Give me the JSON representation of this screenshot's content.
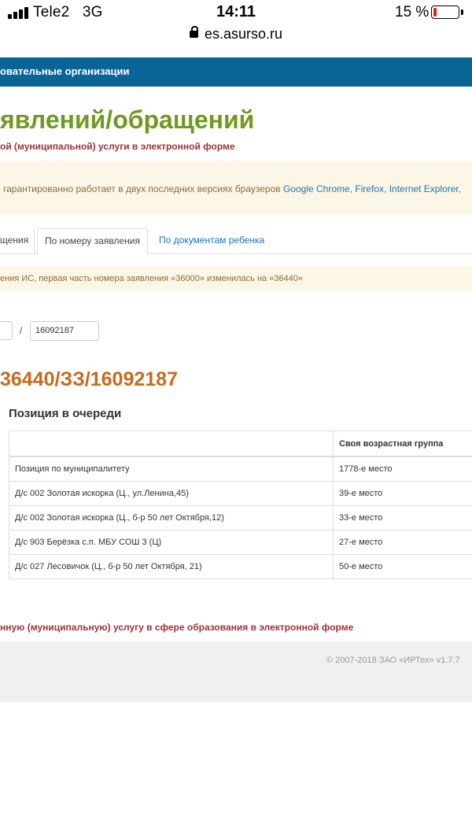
{
  "status_bar": {
    "carrier": "Tele2",
    "network": "3G",
    "time": "14:11",
    "battery_percent": "15 %",
    "battery_level": 0.15,
    "battery_color": "#e0221b",
    "url": "es.asurso.ru"
  },
  "nav": {
    "label": "овательные организации"
  },
  "page": {
    "title": "явлений/обращений",
    "subtitle": "ой (муниципальной) услуги в электронной форме"
  },
  "browser_alert": {
    "text": "гарантированно работает в двух последних версиях браузеров ",
    "browser_1": "Google Chrome",
    "sep_1": ", ",
    "browser_2": "Firefox",
    "sep_2": ", ",
    "browser_3": "Internet Explorer",
    "sep_3": ","
  },
  "tabs": [
    {
      "label": "щения"
    },
    {
      "label": "По номеру заявления"
    },
    {
      "label": "По документам ребенка"
    }
  ],
  "info_alert": {
    "text": "ения ИС, первая часть номера заявления «36000» изменилась на «36440»"
  },
  "search": {
    "separator": "/",
    "number_value": "16092187"
  },
  "application_number": "36440/ЗЗ/16092187",
  "queue": {
    "heading": "Позиция в очереди",
    "columns": [
      "",
      "Своя возрастная группа"
    ],
    "rows": [
      [
        "Позиция по муниципалитету",
        "1778-е место"
      ],
      [
        "Д/с 002 Золотая искорка (Ц., ул.Ленина,45)",
        "39-е место"
      ],
      [
        "Д/с 002 Золотая искорка (Ц., б-р 50 лет Октября,12)",
        "33-е место"
      ],
      [
        "Д/с 903 Берёзка с.п. МБУ СОШ 3 (Ц)",
        "27-е место"
      ],
      [
        "Д/с 027 Лесовичок (Ц., б-р 50 лет Октября, 21)",
        "50-е место"
      ]
    ]
  },
  "footer": {
    "link": "нную (муниципальную) услугу в сфере образования в электронной форме",
    "copyright": "© 2007-2018 ЗАО «ИРТех» v1.7.7"
  },
  "colors": {
    "nav_bg": "#0a6597",
    "title": "#6e9a1e",
    "accent_red": "#a0323b",
    "app_number": "#c86b1a",
    "link": "#1a75b8",
    "alert_bg": "#fcf6e6"
  }
}
